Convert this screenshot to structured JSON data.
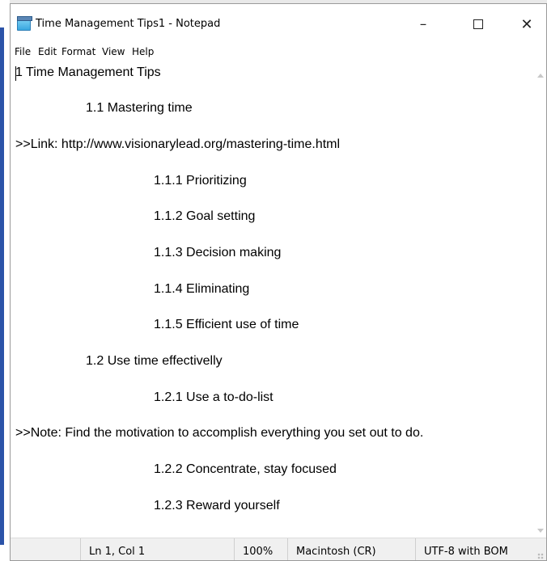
{
  "window": {
    "title": "Time Management  Tips1 - Notepad",
    "icon": "notepad-icon",
    "controls": {
      "minimize": "–",
      "maximize": "",
      "close": "✕"
    }
  },
  "menu": [
    "File",
    "Edit",
    "Format",
    "View",
    "Help"
  ],
  "editor": {
    "lines": [
      "1 Time Management  Tips",
      "1.1 Mastering time",
      ">>Link: http://www.visionarylead.org/mastering-time.html",
      "1.1.1 Prioritizing",
      "1.1.2 Goal setting",
      "1.1.3 Decision making",
      "1.1.4 Eliminating",
      "1.1.5 Efficient use of time",
      "1.2 Use time effectivelly",
      "1.2.1 Use a to-do-list",
      ">>Note: Find the motivation to accomplish everything you set out to do.",
      "1.2.2 Concentrate,  stay focused",
      "1.2.3 Reward yourself"
    ]
  },
  "status": {
    "position": "Ln 1, Col 1",
    "zoom": "100%",
    "line_ending": "Macintosh (CR)",
    "encoding": "UTF-8 with BOM"
  },
  "colors": {
    "accent_left": "#2b53a8"
  }
}
